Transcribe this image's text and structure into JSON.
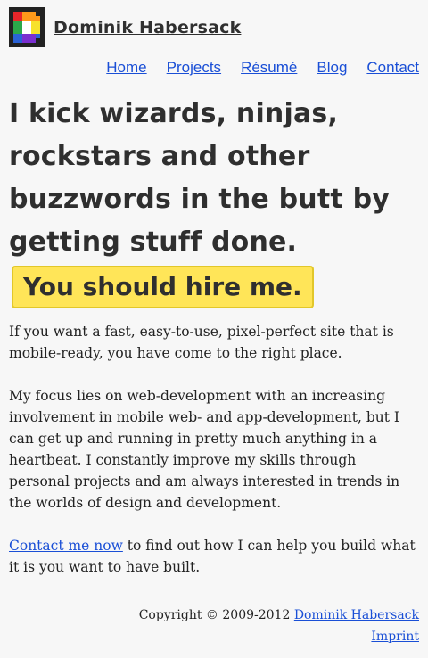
{
  "header": {
    "site_name": "Dominik Habersack",
    "logo_icon": "pixel-d-logo-icon"
  },
  "nav": {
    "items": [
      {
        "label": "Home"
      },
      {
        "label": "Projects"
      },
      {
        "label": "Résumé"
      },
      {
        "label": "Blog"
      },
      {
        "label": "Contact"
      }
    ]
  },
  "hero": {
    "headline": "I kick wizards, ninjas, rockstars and other buzzwords in the butt by getting stuff done.",
    "hire_text": "You should hire me."
  },
  "content": {
    "para1": "If you want a fast, easy-to-use, pixel-perfect site that is mobile-ready, you have come to the right place.",
    "para2": "My focus lies on web-development with an increasing involvement in mobile web- and app-development, but I can get up and running in pretty much anything in a heartbeat. I constantly improve my skills through personal projects and am always interested in trends in the worlds of design and development.",
    "contact_link": "Contact me now",
    "para3_rest": " to find out how I can help you build what it is you want to have built."
  },
  "footer": {
    "copyright": "Copyright © 2009-2012 ",
    "author_link": "Dominik Habersack",
    "imprint_link": "Imprint"
  },
  "colors": {
    "link": "#1a4fd6",
    "hire_bg": "#ffe558",
    "text": "#222222"
  }
}
